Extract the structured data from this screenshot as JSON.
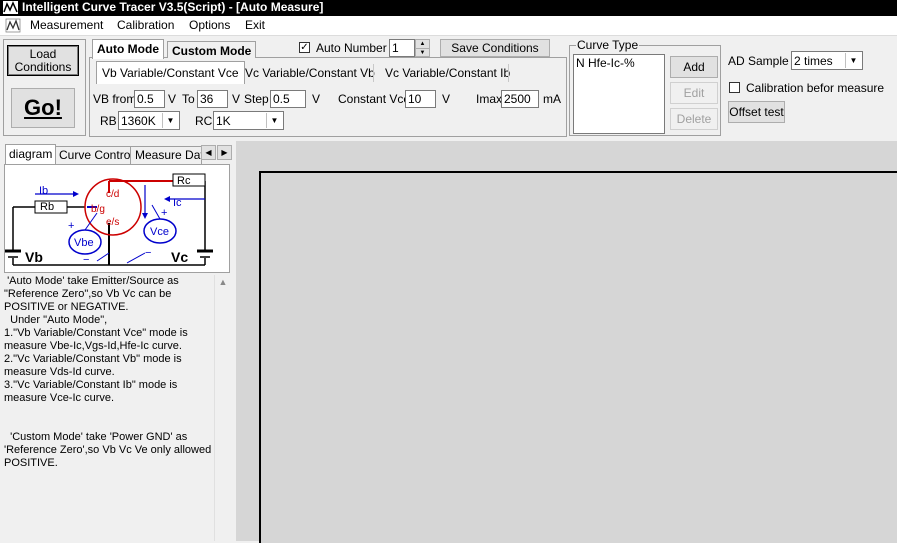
{
  "window": {
    "title": "Intelligent Curve Tracer V3.5(Script) - [Auto Measure]"
  },
  "menu": [
    "Measurement",
    "Calibration",
    "Options",
    "Exit"
  ],
  "left_buttons": {
    "load": "Load\nConditions",
    "go": "Go!"
  },
  "mode_tabs": [
    "Auto Mode",
    "Custom Mode"
  ],
  "auto_number": {
    "label": "Auto Number",
    "checked": true,
    "value": "1"
  },
  "save_conditions": "Save Conditions",
  "sub_tabs": [
    "Vb Variable/Constant Vce",
    "Vc Variable/Constant Vb",
    "Vc Variable/Constant Ib"
  ],
  "params": {
    "vb_from_label": "VB from",
    "vb_from": "0.5",
    "v1": "V",
    "to_label": "To",
    "to": "36",
    "v2": "V",
    "step_label": "Step",
    "step": "0.5",
    "v3": "V",
    "constant_vce_label": "Constant Vce",
    "constant_vce": "10",
    "v4": "V",
    "imax_label": "Imax",
    "imax": "2500",
    "ma": "mA",
    "rb_label": "RB",
    "rb": "1360K",
    "rc_label": "RC",
    "rc": "1K"
  },
  "curve_type": {
    "label": "Curve Type",
    "items": [
      "N Hfe-Ic-%"
    ],
    "add": "Add",
    "edit": "Edit",
    "delete": "Delete"
  },
  "ad_sample": {
    "label": "AD Sample",
    "value": "2 times",
    "calibration_label": "Calibration befor measure",
    "calibration_checked": false,
    "offset": "Offset test"
  },
  "left_tabs": [
    "diagram",
    "Curve Control",
    "Measure Data"
  ],
  "diagram": {
    "rc": "Rc",
    "rb": "Rb",
    "ib": "Ib",
    "ic": "Ic",
    "cd": "c/d",
    "bg": "b/g",
    "es": "e/s",
    "vbe": "Vbe",
    "vce": "Vce",
    "vb": "Vb",
    "vc": "Vc",
    "plus1": "+",
    "minus1": "−",
    "plus2": "+",
    "minus2": "−"
  },
  "description": " 'Auto Mode' take Emitter/Source as \"Reference Zero\",so Vb Vc can be POSITIVE or NEGATIVE.\n  Under \"Auto Mode\",\n1.\"Vb Variable/Constant Vce\" mode is measure Vbe-Ic,Vgs-Id,Hfe-Ic curve.\n2.\"Vc Variable/Constant Vb\" mode is measure Vds-Id curve.\n3.\"Vc Variable/Constant Ib\" mode is measure Vce-Ic curve.\n\n\n  'Custom Mode' take 'Power GND' as 'Reference Zero',so Vb Vc Ve only allowed POSITIVE."
}
